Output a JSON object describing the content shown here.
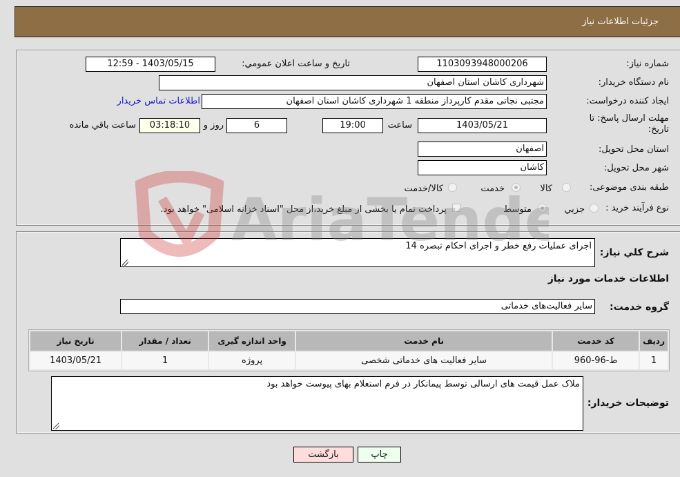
{
  "header": {
    "title": "جزئیات اطلاعات نیاز"
  },
  "details": {
    "need_number": {
      "label": "شماره نیاز:",
      "value": "1103093948000206"
    },
    "announce_datetime": {
      "label": "تاریخ و ساعت اعلان عمومي:",
      "value": "1403/05/15 - 12:59"
    },
    "buyer_org": {
      "label": "نام دستگاه خریدار:",
      "value": "شهرداری کاشان استان اصفهان"
    },
    "requester": {
      "label": "ایجاد کننده درخواست:",
      "value": "مجتبی نجاتی مقدم کارپرداز منطقه 1 شهرداری کاشان استان اصفهان"
    },
    "buyer_contact_link": "اطلاعات تماس خریدار",
    "deadline": {
      "label_line1": "مهلت ارسال پاسخ: تا",
      "label_line2": "تاریخ:",
      "date": "1403/05/21",
      "time_label": "ساعت",
      "time": "19:00",
      "days": "6",
      "days_label": "روز و",
      "remaining": "03:18:10",
      "remaining_label": "ساعت باقي مانده"
    },
    "province": {
      "label": "استان محل تحویل:",
      "value": "اصفهان"
    },
    "city": {
      "label": "شهر محل تحویل:",
      "value": "کاشان"
    },
    "category": {
      "label": "طبقه بندی موضوعی:",
      "options": [
        "کالا",
        "خدمت",
        "کالا/خدمت"
      ],
      "selected": "خدمت"
    },
    "purchase_type": {
      "label": "نوع فرآیند خرید :",
      "options": [
        "جزيي",
        "متوسط"
      ],
      "selected": "متوسط",
      "treasury_note": "پرداخت تمام یا بخشی از مبلغ خرید،از محل \"اسناد خزانه اسلامی\" خواهد بود.",
      "treasury_checked": false
    }
  },
  "description": {
    "label": "شرح کلي نياز:",
    "value": "اجرای عملیات رفع خطر و اجرای احکام تبصره 14"
  },
  "services": {
    "section_title": "اطلاعات خدمات مورد نیاز",
    "group_label": "گروه خدمت:",
    "group_value": "سایر فعالیت‌های خدماتی",
    "columns": [
      "ردیف",
      "کد خدمت",
      "نام خدمت",
      "واحد اندازه گیری",
      "تعداد / مقدار",
      "تاریخ نیاز"
    ],
    "rows": [
      [
        "1",
        "ط-96-960",
        "سایر فعالیت های خدماتی شخصی",
        "پروژه",
        "1",
        "1403/05/21"
      ]
    ]
  },
  "buyer_notes": {
    "label": "توضیحات خریدار:",
    "value": "ملاک عمل قیمت های ارسالی توسط پیمانکار در فرم استعلام بهای پیوست خواهد بود"
  },
  "buttons": {
    "print": "چاپ",
    "back": "بازگشت"
  },
  "watermark": "AriaTender.neT"
}
